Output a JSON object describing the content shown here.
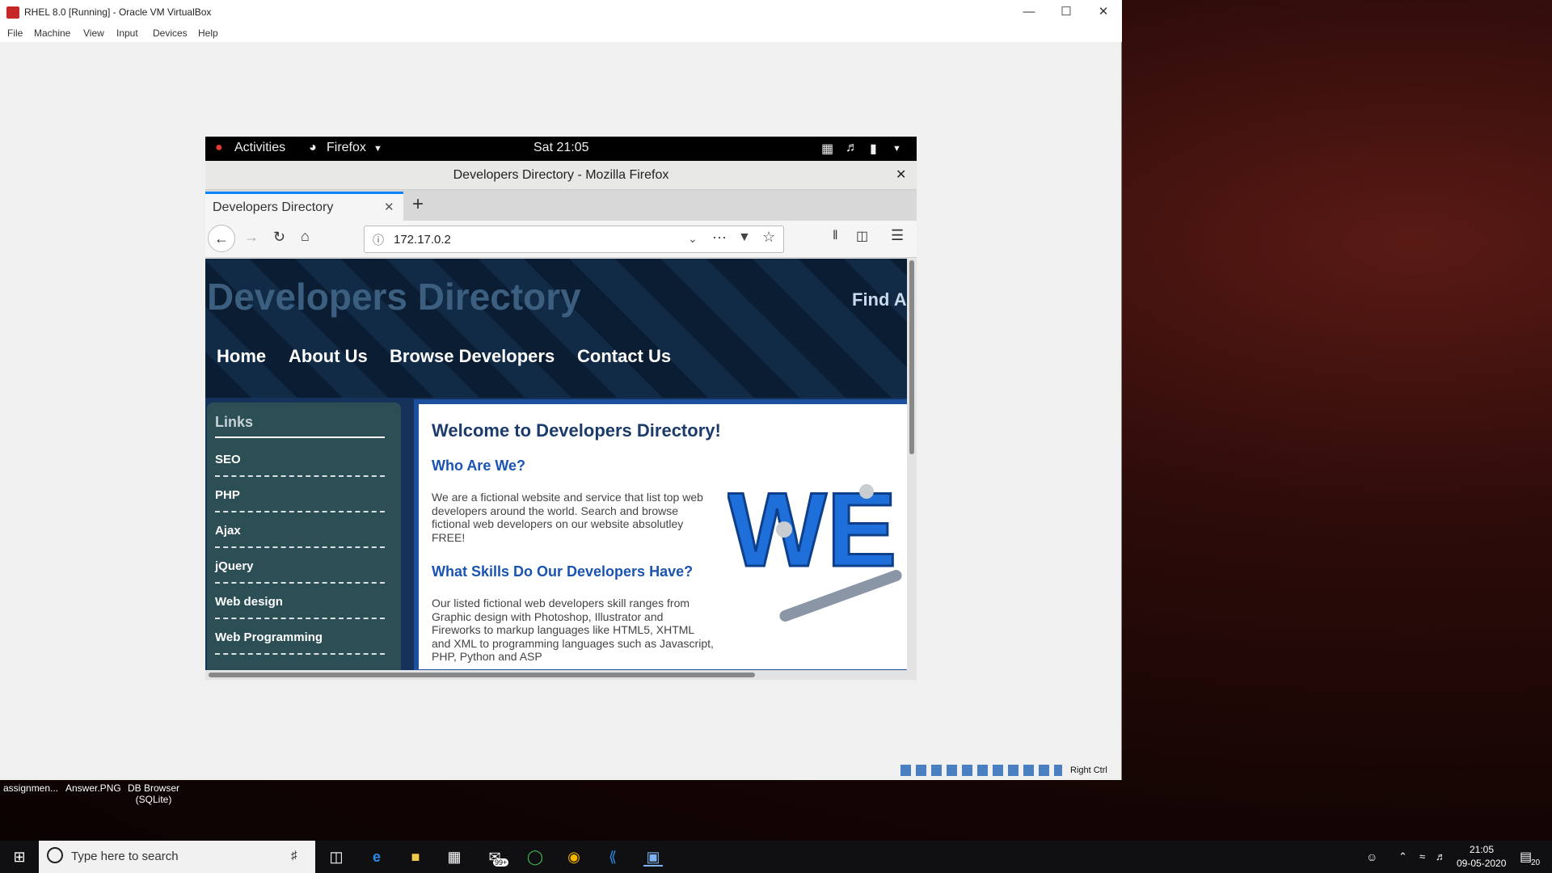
{
  "vbox": {
    "title": "RHEL 8.0 [Running] - Oracle VM VirtualBox",
    "menu": [
      "File",
      "Machine",
      "View",
      "Input",
      "Devices",
      "Help"
    ],
    "host_key": "Right Ctrl"
  },
  "gnome": {
    "activities": "Activities",
    "app": "Firefox",
    "clock": "Sat 21:05"
  },
  "firefox": {
    "window_title": "Developers Directory - Mozilla Firefox",
    "tab_label": "Developers Directory",
    "url": "172.17.0.2"
  },
  "site": {
    "title": "Developers Directory",
    "find": "Find A",
    "nav": [
      "Home",
      "About Us",
      "Browse Developers",
      "Contact Us"
    ],
    "sidebar": {
      "heading": "Links",
      "links": [
        "SEO",
        "PHP",
        "Ajax",
        "jQuery",
        "Web design",
        "Web Programming"
      ]
    },
    "main": {
      "heading": "Welcome to Developers Directory!",
      "who_title": "Who Are We?",
      "who_text": "We are a fictional website and service that list top web developers around the world. Search and browse fictional web developers on our website absolutley FREE!",
      "skills_title": "What Skills Do Our Developers Have?",
      "skills_text": "Our listed fictional web developers skill ranges from Graphic design with Photoshop, Illustrator and Fireworks to markup languages like HTML5, XHTML and XML to programming languages such as Javascript, PHP, Python and ASP",
      "image_text": "WE"
    }
  },
  "desktop": {
    "items": [
      "assignmen...",
      "Answer.PNG",
      "DB Browser (SQLite)"
    ]
  },
  "taskbar": {
    "search_placeholder": "Type here to search",
    "mail_badge": "99+",
    "time": "21:05",
    "date": "09-05-2020",
    "notification_count": "20"
  },
  "colors": {
    "site_header": "#0d2038",
    "sidebar": "#2c4e55",
    "main_border": "#1c4f9c",
    "heading_link": "#1a54b2"
  }
}
